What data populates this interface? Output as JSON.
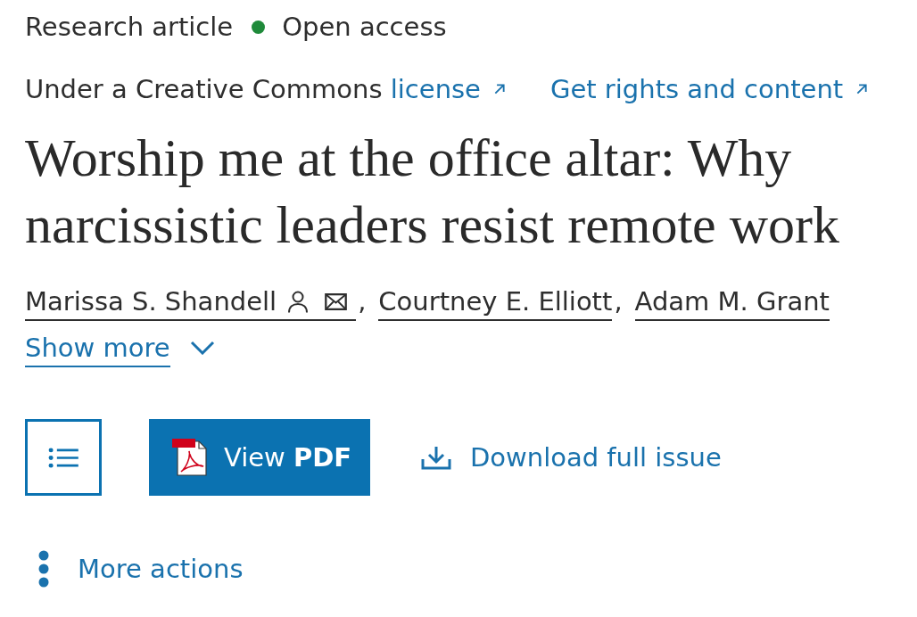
{
  "article_type": "Research article",
  "access": {
    "label": "Open access",
    "open": true
  },
  "license": {
    "text": "Under a Creative Commons",
    "link": "license"
  },
  "rights_link": "Get rights and content",
  "title": "Worship me at the office altar: Why narcissistic leaders resist remote work",
  "authors": [
    {
      "name": "Marissa S. Shandell",
      "profile": true,
      "email": true
    },
    {
      "name": "Courtney E. Elliott",
      "profile": false,
      "email": false
    },
    {
      "name": "Adam M. Grant",
      "profile": false,
      "email": false
    }
  ],
  "author_separator": ",",
  "show_more": {
    "label": "Show more",
    "expanded": false
  },
  "actions": [
    {
      "kind": "outline"
    },
    {
      "kind": "primary",
      "label": "View **PDF**"
    },
    {
      "kind": "download",
      "label": "Download full issue"
    }
  ],
  "more_actions": {
    "label": "More actions"
  }
}
